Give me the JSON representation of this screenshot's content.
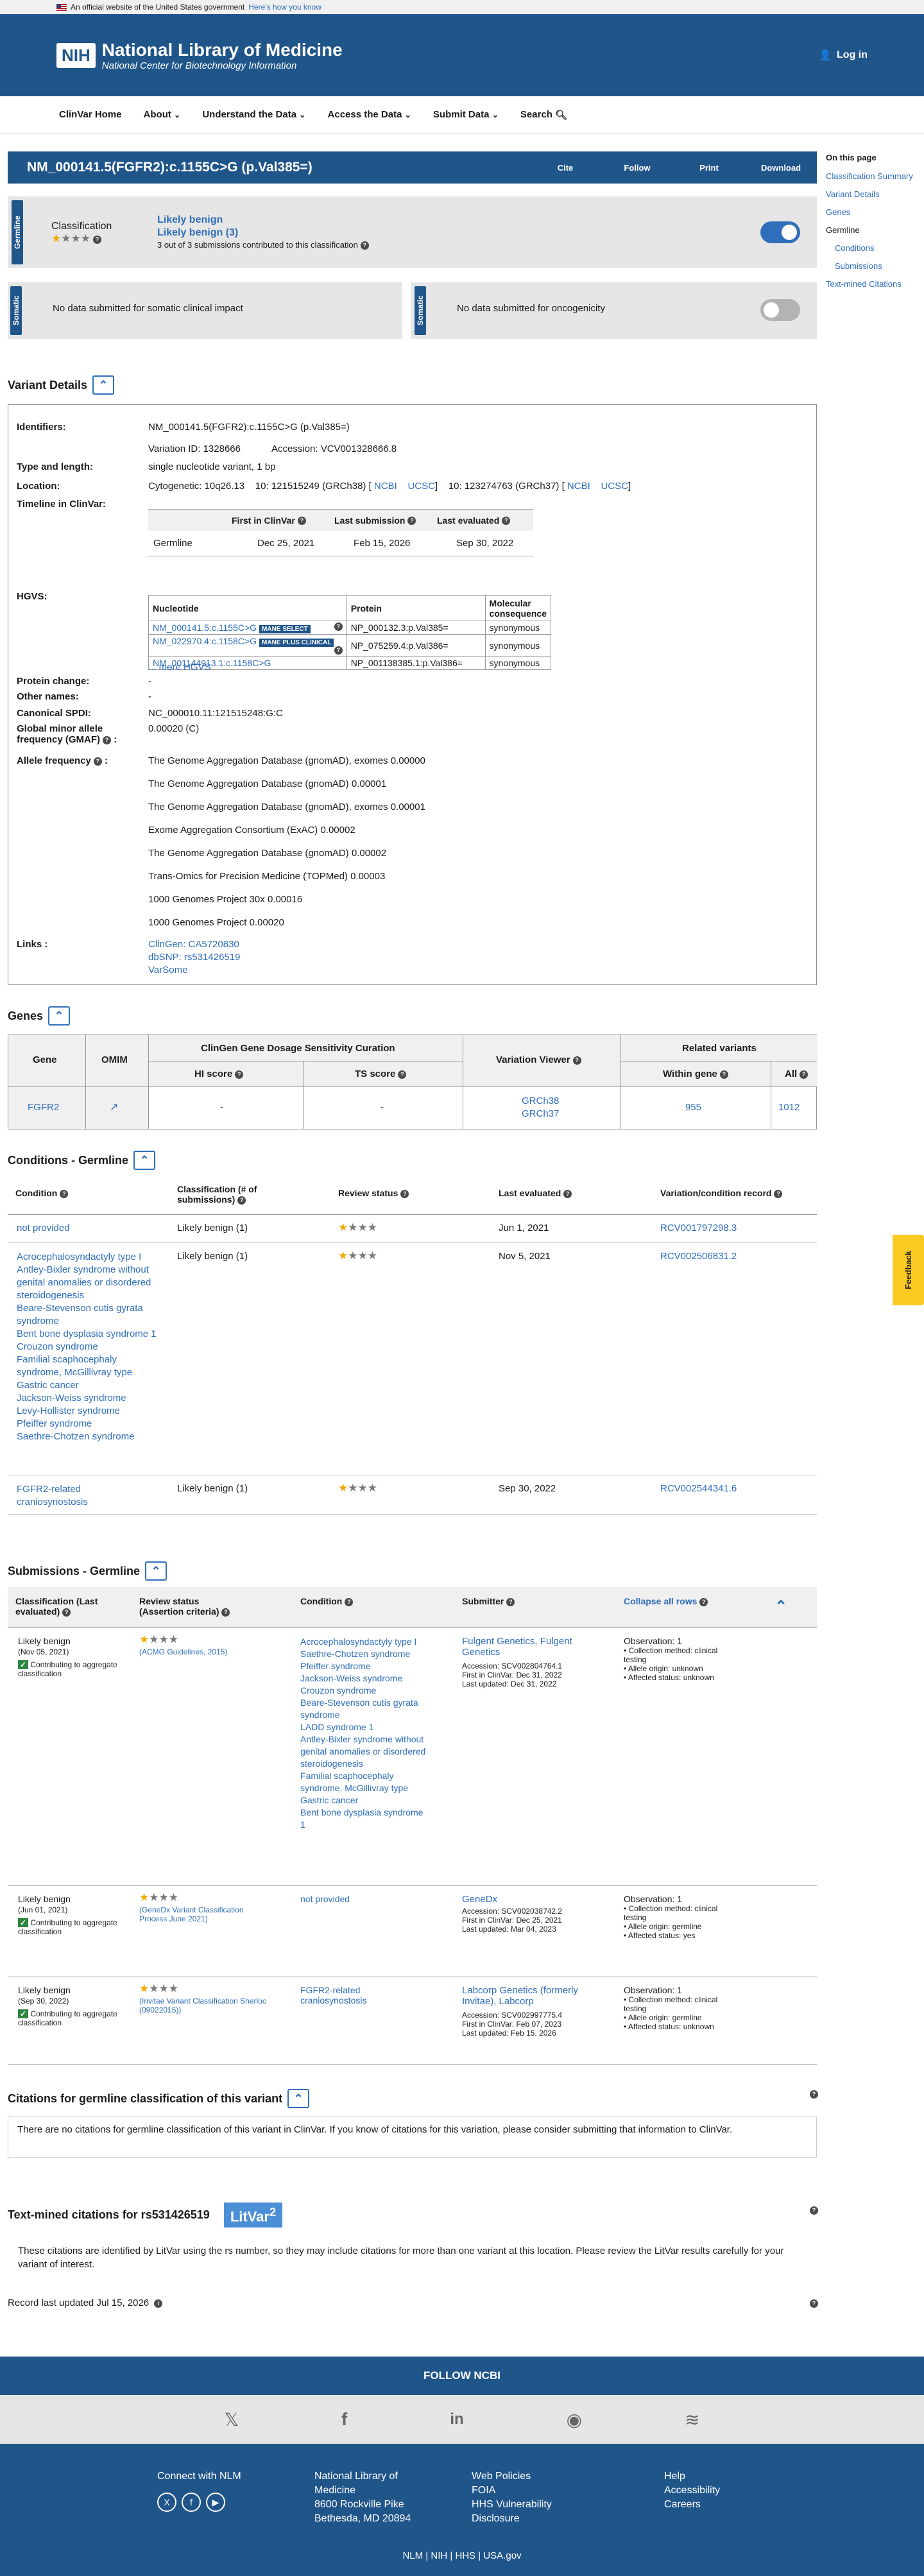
{
  "gov_banner": {
    "text": "An official website of the United States government",
    "link": "Here's how you know"
  },
  "header": {
    "logo": "NIH",
    "title": "National Library of Medicine",
    "subtitle": "National Center for Biotechnology Information",
    "login": "Log in"
  },
  "nav": [
    "ClinVar Home",
    "About",
    "Understand the Data",
    "Access the Data",
    "Submit Data",
    "Search"
  ],
  "title": "NM_000141.5(FGFR2):c.1155C>G (p.Val385=)",
  "actions": [
    "Cite",
    "Follow",
    "Print",
    "Download"
  ],
  "sidebar": {
    "heading": "On this page",
    "items": [
      "Classification Summary",
      "Variant Details",
      "Genes",
      "Germline",
      "Conditions",
      "Submissions",
      "Text-mined Citations"
    ]
  },
  "germline": {
    "tag": "Germline",
    "label": "Classification",
    "stars": 1,
    "class1": "Likely benign",
    "class2": "Likely benign (3)",
    "submissions": "3 out of 3 submissions contributed to this classification"
  },
  "somatic": {
    "tag": "Somatic",
    "impact": "No data submitted for somatic clinical impact",
    "oncogenicity": "No data submitted for oncogenicity"
  },
  "variant_details": {
    "heading": "Variant Details",
    "identifiers_label": "Identifiers:",
    "identifiers": "NM_000141.5(FGFR2):c.1155C>G (p.Val385=)",
    "variation_id": "Variation ID: 1328666",
    "accession": "Accession: VCV001328666.8",
    "type_label": "Type and length:",
    "type": "single nucleotide variant, 1 bp",
    "location_label": "Location:",
    "cyto": "Cytogenetic: 10q26.13",
    "grch38": "10: 121515249 (GRCh38) [",
    "grch37": "10: 123274763 (GRCh37) [",
    "ncbi": "NCBI",
    "ucsc": "UCSC",
    "close": "]",
    "timeline_label": "Timeline in ClinVar:",
    "timeline_head": [
      "First in ClinVar",
      "Last submission",
      "Last evaluated"
    ],
    "timeline_row": [
      "Germline",
      "Dec 25, 2021",
      "Feb 15, 2026",
      "Sep 30, 2022"
    ],
    "hgvs_label": "HGVS:",
    "hgvs_head": [
      "Nucleotide",
      "Protein",
      "Molecular consequence"
    ],
    "hgvs_rows": [
      {
        "n": "NM_000141.5:c.1155C>G",
        "b": "MANE SELECT",
        "p": "NP_000132.3:p.Val385=",
        "c": "synonymous"
      },
      {
        "n": "NM_022970.4:c.1158C>G",
        "b": "MANE PLUS CLINICAL",
        "p": "NP_075259.4:p.Val386=",
        "c": "synonymous"
      },
      {
        "n": "NM_001144913.1:c.1158C>G",
        "b": "",
        "p": "NP_001138385.1:p.Val386=",
        "c": "synonymous"
      }
    ],
    "more_hgvs": "... more HGVS",
    "protein_label": "Protein change:",
    "protein": "-",
    "other_label": "Other names:",
    "other": "-",
    "spdi_label": "Canonical SPDI:",
    "spdi": "NC_000010.11:121515248:G:C",
    "gmaf_label": "Global minor allele frequency (GMAF)",
    "gmaf": "0.00020 (C)",
    "af_label": "Allele frequency",
    "af": [
      "The Genome Aggregation Database (gnomAD), exomes 0.00000",
      "The Genome Aggregation Database (gnomAD) 0.00001",
      "The Genome Aggregation Database (gnomAD), exomes 0.00001",
      "Exome Aggregation Consortium (ExAC) 0.00002",
      "The Genome Aggregation Database (gnomAD) 0.00002",
      "Trans-Omics for Precision Medicine (TOPMed) 0.00003",
      "1000 Genomes Project 30x 0.00016",
      "1000 Genomes Project 0.00020"
    ],
    "links_label": "Links :",
    "links": [
      "ClinGen: CA5720830",
      "dbSNP: rs531426519",
      "VarSome"
    ]
  },
  "genes": {
    "heading": "Genes",
    "h_gene": "Gene",
    "h_omim": "OMIM",
    "h_clingen": "ClinGen Gene Dosage Sensitivity Curation",
    "h_hi": "HI score",
    "h_ts": "TS score",
    "h_viewer": "Variation Viewer",
    "h_related": "Related variants",
    "h_within": "Within gene",
    "h_all": "All",
    "gene": "FGFR2",
    "hi": "-",
    "ts": "-",
    "v38": "GRCh38",
    "v37": "GRCh37",
    "within": "955",
    "all": "1012"
  },
  "conditions": {
    "heading": "Conditions - Germline",
    "h": [
      "Condition",
      "Classification (# of submissions)",
      "Review status",
      "Last evaluated",
      "Variation/condition record"
    ],
    "rows": [
      {
        "cond": [
          "not provided"
        ],
        "cls": "Likely benign (1)",
        "date": "Jun 1, 2021",
        "rec": "RCV001797298.3"
      },
      {
        "cond": [
          "Acrocephalosyndactyly type I",
          "Antley-Bixler syndrome without genital anomalies or disordered steroidogenesis",
          "Beare-Stevenson cutis gyrata syndrome",
          "Bent bone dysplasia syndrome 1",
          "Crouzon syndrome",
          "Familial scaphocephaly syndrome, McGillivray type",
          "Gastric cancer",
          "Jackson-Weiss syndrome",
          "Levy-Hollister syndrome",
          "Pfeiffer syndrome",
          "Saethre-Chotzen syndrome"
        ],
        "cls": "Likely benign (1)",
        "date": "Nov 5, 2021",
        "rec": "RCV002506831.2"
      },
      {
        "cond": [
          "FGFR2-related craniosynostosis"
        ],
        "cls": "Likely benign (1)",
        "date": "Sep 30, 2022",
        "rec": "RCV002544341.6"
      }
    ]
  },
  "submissions": {
    "heading": "Submissions - Germline",
    "h": [
      "Classification (Last evaluated)",
      "Review status (Assertion criteria)",
      "Condition",
      "Submitter",
      "Collapse all rows"
    ],
    "rows": [
      {
        "cls": "Likely benign",
        "date": "(Nov 05, 2021)",
        "contrib": "Contributing to aggregate classification",
        "crit": "(ACMG Guidelines, 2015)",
        "cond": [
          "Acrocephalosyndactyly type I",
          "Saethre-Chotzen syndrome",
          "Pfeiffer syndrome",
          "Jackson-Weiss syndrome",
          "Crouzon syndrome",
          "Beare-Stevenson cutis gyrata syndrome",
          "LADD syndrome 1",
          "Antley-Bixler syndrome without genital anomalies or disordered steroidogenesis",
          "Familial scaphocephaly syndrome, McGillivray type",
          "Gastric cancer",
          "Bent bone dysplasia syndrome 1"
        ],
        "sub": "Fulgent Genetics, Fulgent Genetics",
        "acc": "Accession: SCV002804764.1",
        "first": "First in ClinVar: Dec 31, 2022",
        "upd": "Last updated: Dec 31, 2022",
        "obs": "Observation: 1",
        "o1": "Collection method: clinical testing",
        "o2": "Allele origin: unknown",
        "o3": "Affected status: unknown"
      },
      {
        "cls": "Likely benign",
        "date": "(Jun 01, 2021)",
        "contrib": "Contributing to aggregate classification",
        "crit": "(GeneDx Variant Classification Process June 2021)",
        "cond": [
          "not provided"
        ],
        "sub": "GeneDx",
        "acc": "Accession: SCV002038742.2",
        "first": "First in ClinVar: Dec 25, 2021",
        "upd": "Last updated: Mar 04, 2023",
        "obs": "Observation: 1",
        "o1": "Collection method: clinical testing",
        "o2": "Allele origin: germline",
        "o3": "Affected status: yes"
      },
      {
        "cls": "Likely benign",
        "date": "(Sep 30, 2022)",
        "contrib": "Contributing to aggregate classification",
        "crit": "(Invitae Variant Classification Sherloc (09022015))",
        "cond": [
          "FGFR2-related craniosynostosis"
        ],
        "sub": "Labcorp Genetics (formerly Invitae), Labcorp",
        "acc": "Accession: SCV002997775.4",
        "first": "First in ClinVar: Feb 07, 2023",
        "upd": "Last updated: Feb 15, 2026",
        "obs": "Observation: 1",
        "o1": "Collection method: clinical testing",
        "o2": "Allele origin: germline",
        "o3": "Affected status: unknown"
      }
    ]
  },
  "citations": {
    "heading": "Citations for germline classification of this variant",
    "text": "There are no citations for germline classification of this variant in ClinVar. If you know of citations for this variation, please consider submitting that information to ClinVar."
  },
  "textmined": {
    "heading": "Text-mined citations for rs531426519",
    "litvar": "LitVar",
    "sup": "2",
    "text": "These citations are identified by LitVar using the rs number, so they may include citations for more than one variant at this location. Please review the LitVar results carefully for your variant of interest."
  },
  "record": "Record last updated Jul 15, 2026",
  "feedback": "Feedback",
  "footer": {
    "follow": "FOLLOW NCBI",
    "connect": "Connect with NLM",
    "nlm": [
      "National Library of",
      "Medicine",
      "8600 Rockville Pike",
      "Bethesda, MD 20894"
    ],
    "col3": [
      "Web Policies",
      "FOIA",
      "HHS Vulnerability",
      "Disclosure"
    ],
    "col4": [
      "Help",
      "Accessibility",
      "Careers"
    ],
    "bottom": [
      "NLM",
      "NIH",
      "HHS",
      "USA.gov"
    ]
  }
}
